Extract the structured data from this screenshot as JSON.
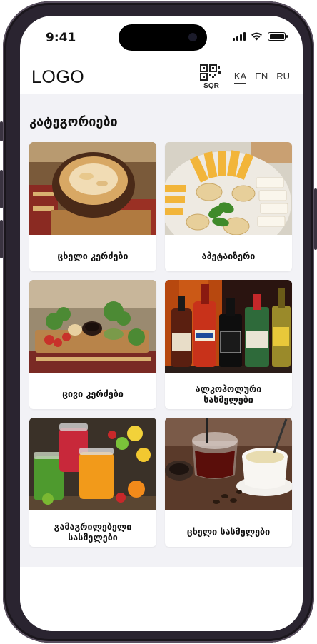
{
  "status_bar": {
    "time": "9:41"
  },
  "header": {
    "logo_text": "LOGO",
    "qr_brand": "SQR",
    "languages": [
      "KA",
      "EN",
      "RU"
    ],
    "active_language": "KA"
  },
  "main": {
    "title": "კატეგორიები",
    "categories": [
      {
        "label": "ცხელი კერძები",
        "image": "hot-dishes-photo"
      },
      {
        "label": "აპეტაიზერი",
        "image": "appetizer-cheese-plate-photo"
      },
      {
        "label": "ცივი კერძები",
        "image": "cold-dishes-photo"
      },
      {
        "label": "ალკოჰოლური სასმელები",
        "image": "alcohol-bottles-photo"
      },
      {
        "label": "გამაგრილებელი სასმელები",
        "image": "fresh-juices-photo"
      },
      {
        "label": "ცხელი სასმელები",
        "image": "tea-coffee-photo"
      }
    ]
  },
  "colors": {
    "phone_frame": "#2a2430",
    "content_bg": "#f2f2f6",
    "card_bg": "#ffffff"
  }
}
